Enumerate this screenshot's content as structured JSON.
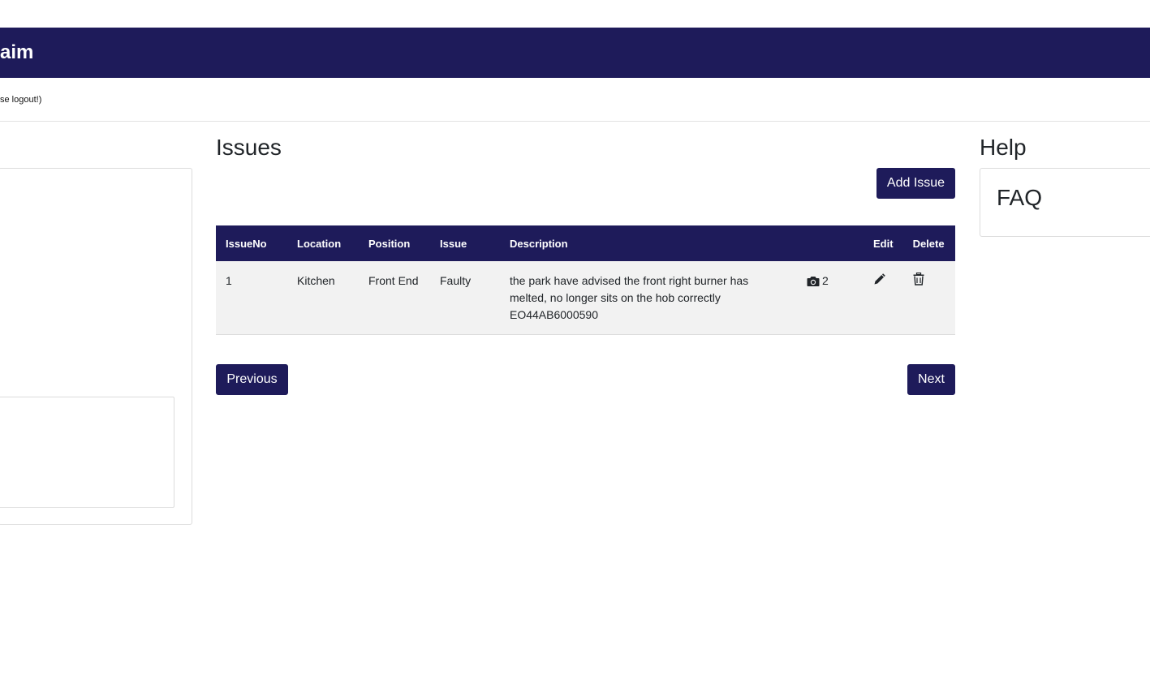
{
  "header": {
    "brand": "aim"
  },
  "subbar": {
    "logout_note": "se logout!)"
  },
  "issues": {
    "title": "Issues",
    "add_button": "Add Issue",
    "columns": {
      "issue_no": "IssueNo",
      "location": "Location",
      "position": "Position",
      "issue": "Issue",
      "description": "Description",
      "edit": "Edit",
      "delete": "Delete"
    },
    "rows": [
      {
        "issue_no": "1",
        "location": "Kitchen",
        "position": "Front End",
        "issue": "Faulty",
        "description": "the park have advised the front right burner has melted, no longer sits on the hob correctly EO44AB6000590",
        "photo_count": "2"
      }
    ],
    "pagination": {
      "previous": "Previous",
      "next": "Next"
    }
  },
  "help": {
    "title": "Help",
    "faq": "FAQ"
  },
  "colors": {
    "primary": "#1e1b5a",
    "row_bg": "#f2f2f2"
  },
  "icons": {
    "photos": "camera-icon",
    "edit": "pencil-icon",
    "delete": "trash-icon"
  }
}
